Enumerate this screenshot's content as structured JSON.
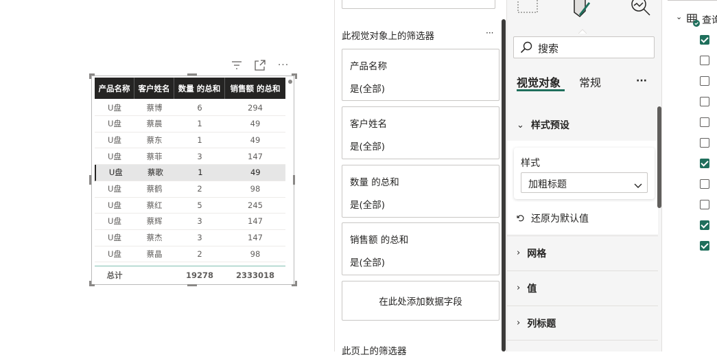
{
  "table": {
    "headers": [
      "产品名称",
      "客户姓名",
      "数量 的总和",
      "销售额 的总和"
    ],
    "rows": [
      [
        "U盘",
        "蔡博",
        "6",
        "294"
      ],
      [
        "U盘",
        "蔡晨",
        "1",
        "49"
      ],
      [
        "U盘",
        "蔡东",
        "1",
        "49"
      ],
      [
        "U盘",
        "蔡菲",
        "3",
        "147"
      ],
      [
        "U盘",
        "蔡歌",
        "1",
        "49"
      ],
      [
        "U盘",
        "蔡鹤",
        "2",
        "98"
      ],
      [
        "U盘",
        "蔡红",
        "5",
        "245"
      ],
      [
        "U盘",
        "蔡辉",
        "3",
        "147"
      ],
      [
        "U盘",
        "蔡杰",
        "3",
        "147"
      ],
      [
        "U盘",
        "蔡晶",
        "2",
        "98"
      ]
    ],
    "selected_row": 4,
    "total": {
      "label": "总计",
      "qty": "19278",
      "sales": "2333018"
    }
  },
  "visual_header": {
    "icons": [
      "filter-icon",
      "focus-mode-icon",
      "more-options-icon"
    ],
    "more": "···"
  },
  "filters_pane": {
    "section_title": "此视觉对象上的筛选器",
    "more": "···",
    "cards": [
      {
        "title": "产品名称",
        "value": "是(全部)"
      },
      {
        "title": "客户姓名",
        "value": "是(全部)"
      },
      {
        "title": "数量 的总和",
        "value": "是(全部)"
      },
      {
        "title": "销售额 的总和",
        "value": "是(全部)"
      }
    ],
    "add_field": "在此处添加数据字段",
    "page_filters_title": "此页上的筛选器"
  },
  "format_pane": {
    "search_placeholder": "搜索",
    "tabs": [
      "视觉对象",
      "常规"
    ],
    "active_tab": 0,
    "more": "···",
    "style_preset": {
      "title": "样式预设",
      "label": "样式",
      "selected": "加粗标题",
      "reset": "还原为默认值"
    },
    "sections": [
      "网格",
      "值",
      "列标题"
    ]
  },
  "data_pane": {
    "table_label": "查询",
    "checkboxes": [
      true,
      false,
      false,
      false,
      false,
      false,
      true,
      false,
      false,
      true,
      true
    ]
  },
  "colors": {
    "accent": "#1f6f5c",
    "header_bg": "#252423",
    "selected_row": "#e6e6e6"
  }
}
